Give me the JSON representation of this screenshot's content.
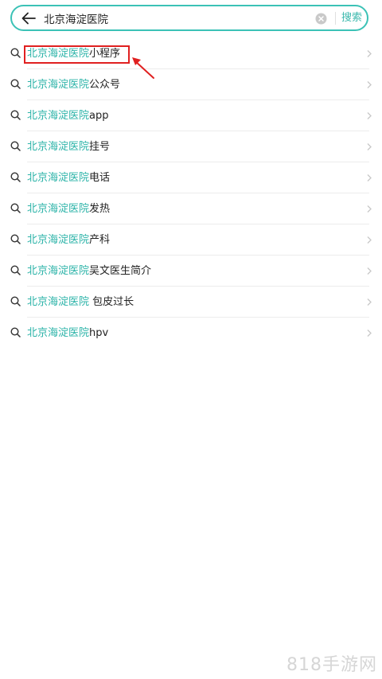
{
  "search": {
    "value": "北京海淀医院",
    "button_label": "搜索"
  },
  "suggestions": [
    {
      "highlight": "北京海淀医院",
      "rest": "小程序"
    },
    {
      "highlight": "北京海淀医院",
      "rest": "公众号"
    },
    {
      "highlight": "北京海淀医院",
      "rest": "app"
    },
    {
      "highlight": "北京海淀医院",
      "rest": "挂号"
    },
    {
      "highlight": "北京海淀医院",
      "rest": "电话"
    },
    {
      "highlight": "北京海淀医院",
      "rest": "发热"
    },
    {
      "highlight": "北京海淀医院",
      "rest": "产科"
    },
    {
      "highlight": "北京海淀医院",
      "rest": "吴文医生简介"
    },
    {
      "highlight": "北京海淀医院",
      "rest": " 包皮过长"
    },
    {
      "highlight": "北京海淀医院",
      "rest": "hpv"
    }
  ],
  "watermark": "818手游网",
  "colors": {
    "accent": "#3bc2b6",
    "highlight_text": "#2bb3a8",
    "annotation": "#e02020"
  },
  "icons": {
    "back": "arrow-left-icon",
    "clear": "clear-circle-icon",
    "row": "search-icon",
    "row_end": "chevron-right-icon"
  }
}
